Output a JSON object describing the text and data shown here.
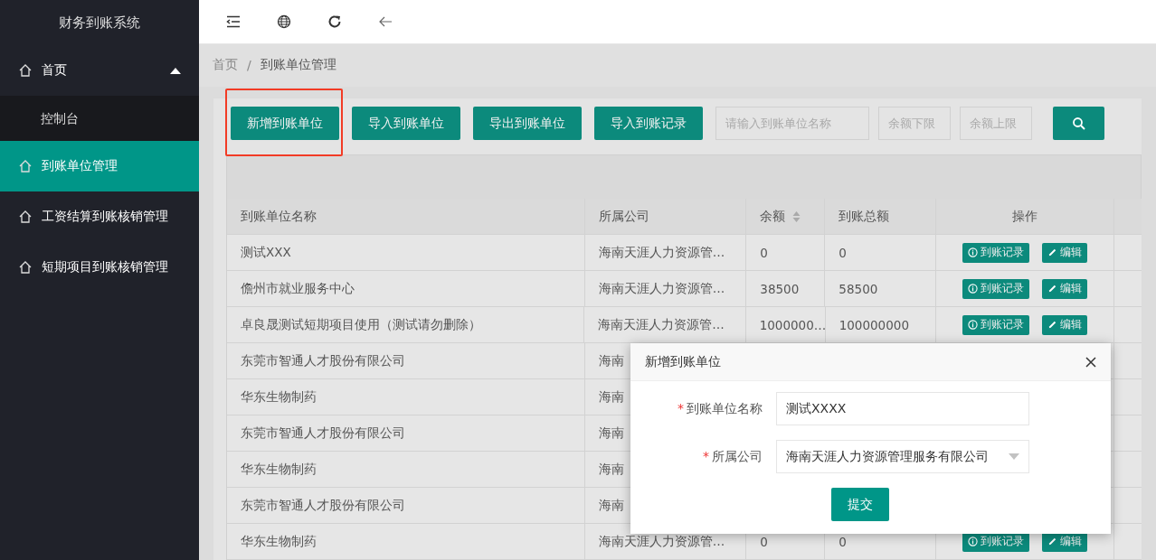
{
  "sidebar": {
    "title": "财务到账系统",
    "items": [
      {
        "label": "首页",
        "selected": false,
        "expanded": true,
        "children": [
          {
            "label": "控制台",
            "selected": false
          }
        ]
      },
      {
        "label": "到账单位管理",
        "selected": true
      },
      {
        "label": "工资结算到账核销管理",
        "selected": false
      },
      {
        "label": "短期项目到账核销管理",
        "selected": false
      }
    ]
  },
  "breadcrumb": {
    "separator": "/",
    "items": [
      "首页",
      "到账单位管理"
    ]
  },
  "toolbar": {
    "buttons": [
      "新增到账单位",
      "导入到账单位",
      "导出到账单位",
      "导入到账记录"
    ],
    "fields": [
      {
        "placeholder": "请输入到账单位名称"
      },
      {
        "placeholder": "余额下限"
      },
      {
        "placeholder": "余额上限"
      }
    ]
  },
  "table": {
    "columns": [
      "到账单位名称",
      "所属公司",
      "余额",
      "到账总额",
      "操作"
    ],
    "rows": [
      {
        "name": "测试XXX",
        "company": "海南天涯人力资源管…",
        "balance": "0",
        "total": "0",
        "actions": [
          "到账记录",
          "编辑"
        ]
      },
      {
        "name": "儋州市就业服务中心",
        "company": "海南天涯人力资源管…",
        "balance": "38500",
        "total": "58500",
        "actions": [
          "到账记录",
          "编辑"
        ]
      },
      {
        "name": "卓良晟测试短期项目使用（测试请勿删除）",
        "company": "海南天涯人力资源管…",
        "balance": "1000000…",
        "total": "100000000",
        "actions": [
          "到账记录",
          "编辑"
        ]
      },
      {
        "name": "东莞市智通人才股份有限公司",
        "company": "海南"
      },
      {
        "name": "华东生物制药",
        "company": "海南"
      },
      {
        "name": "东莞市智通人才股份有限公司",
        "company": "海南"
      },
      {
        "name": "华东生物制药",
        "company": "海南"
      },
      {
        "name": "东莞市智通人才股份有限公司",
        "company": "海南"
      },
      {
        "name": "华东生物制药",
        "company": "海南天涯人力资源管…",
        "balance": "0",
        "total": "0",
        "actions": [
          "到账记录",
          "编辑"
        ]
      }
    ]
  },
  "dialog": {
    "title": "新增到账单位",
    "fields": [
      {
        "kind": "input",
        "label": "到账单位名称",
        "required_mark": "*",
        "value": "测试XXXX"
      },
      {
        "kind": "select",
        "label": "所属公司",
        "required_mark": "*",
        "value": "海南天涯人力资源管理服务有限公司"
      }
    ],
    "submit": "提交"
  }
}
